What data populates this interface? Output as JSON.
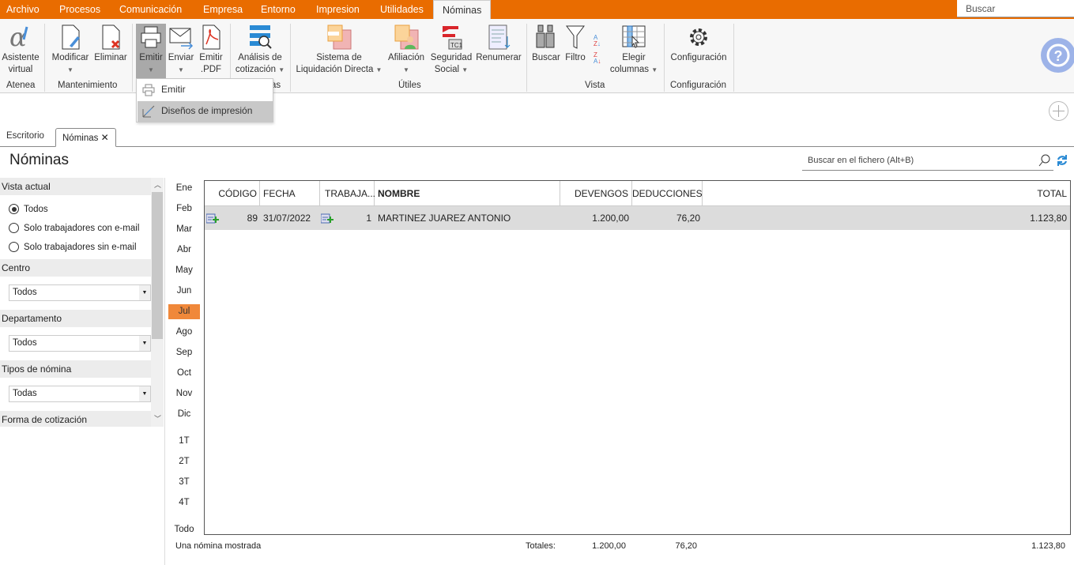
{
  "menu_tabs": [
    "Archivo",
    "Procesos",
    "Comunicación",
    "Empresa",
    "Entorno",
    "Impresion",
    "Utilidades",
    "Nóminas"
  ],
  "active_tab": "Nóminas",
  "global_search": {
    "placeholder": "Buscar"
  },
  "ribbon": {
    "asistente": [
      "Asistente",
      "virtual"
    ],
    "modificar": "Modificar",
    "eliminar": "Eliminar",
    "emitir": "Emitir",
    "enviar": "Enviar",
    "emitir_pdf": [
      "Emitir",
      ".PDF"
    ],
    "analisis": [
      "Análisis de",
      "cotización"
    ],
    "sistema": [
      "Sistema de",
      "Liquidación Directa"
    ],
    "afiliacion": "Afiliación",
    "seguridad": [
      "Seguridad",
      "Social"
    ],
    "renumerar": "Renumerar",
    "buscar": "Buscar",
    "filtro": "Filtro",
    "elegir": [
      "Elegir",
      "columnas"
    ],
    "configuracion": "Configuración",
    "groups": {
      "atenea": "Atenea",
      "mantenimiento": "Mantenimiento",
      "hidden": "as",
      "utiles": "Útiles",
      "vista": "Vista",
      "configuracion": "Configuración"
    }
  },
  "emitir_menu": [
    "Emitir",
    "Diseños de impresión"
  ],
  "doc_tabs": [
    "Escritorio",
    "Nóminas"
  ],
  "page_title": "Nóminas",
  "file_search": {
    "placeholder": "Buscar en el fichero (Alt+B)"
  },
  "filters": {
    "vista_actual": "Vista actual",
    "options": [
      "Todos",
      "Solo trabajadores con e-mail",
      "Solo trabajadores sin e-mail"
    ],
    "selected": 0,
    "centro": {
      "label": "Centro",
      "value": "Todos"
    },
    "departamento": {
      "label": "Departamento",
      "value": "Todos"
    },
    "tipos": {
      "label": "Tipos de nómina",
      "value": "Todas"
    },
    "forma": "Forma de cotización"
  },
  "months": [
    "Ene",
    "Feb",
    "Mar",
    "Abr",
    "May",
    "Jun",
    "Jul",
    "Ago",
    "Sep",
    "Oct",
    "Nov",
    "Dic"
  ],
  "quarters": [
    "1T",
    "2T",
    "3T",
    "4T"
  ],
  "all_label": "Todo",
  "selected_month": "Jul",
  "table": {
    "columns": [
      "CÓDIGO",
      "FECHA",
      "TRABAJA...",
      "NOMBRE",
      "DEVENGOS",
      "DEDUCCIONES",
      "TOTAL"
    ],
    "rows": [
      {
        "codigo": "89",
        "fecha": "31/07/2022",
        "trabajador": "1",
        "nombre": "MARTINEZ JUAREZ ANTONIO",
        "devengos": "1.200,00",
        "deducciones": "76,20",
        "total": "1.123,80"
      }
    ]
  },
  "footer": {
    "status": "Una nómina mostrada",
    "totales_label": "Totales:",
    "devengos": "1.200,00",
    "deducciones": "76,20",
    "total": "1.123,80"
  },
  "colors": {
    "brand": "#E96C00",
    "selected_month": "#F0883A",
    "help": "#9DB3E8"
  }
}
